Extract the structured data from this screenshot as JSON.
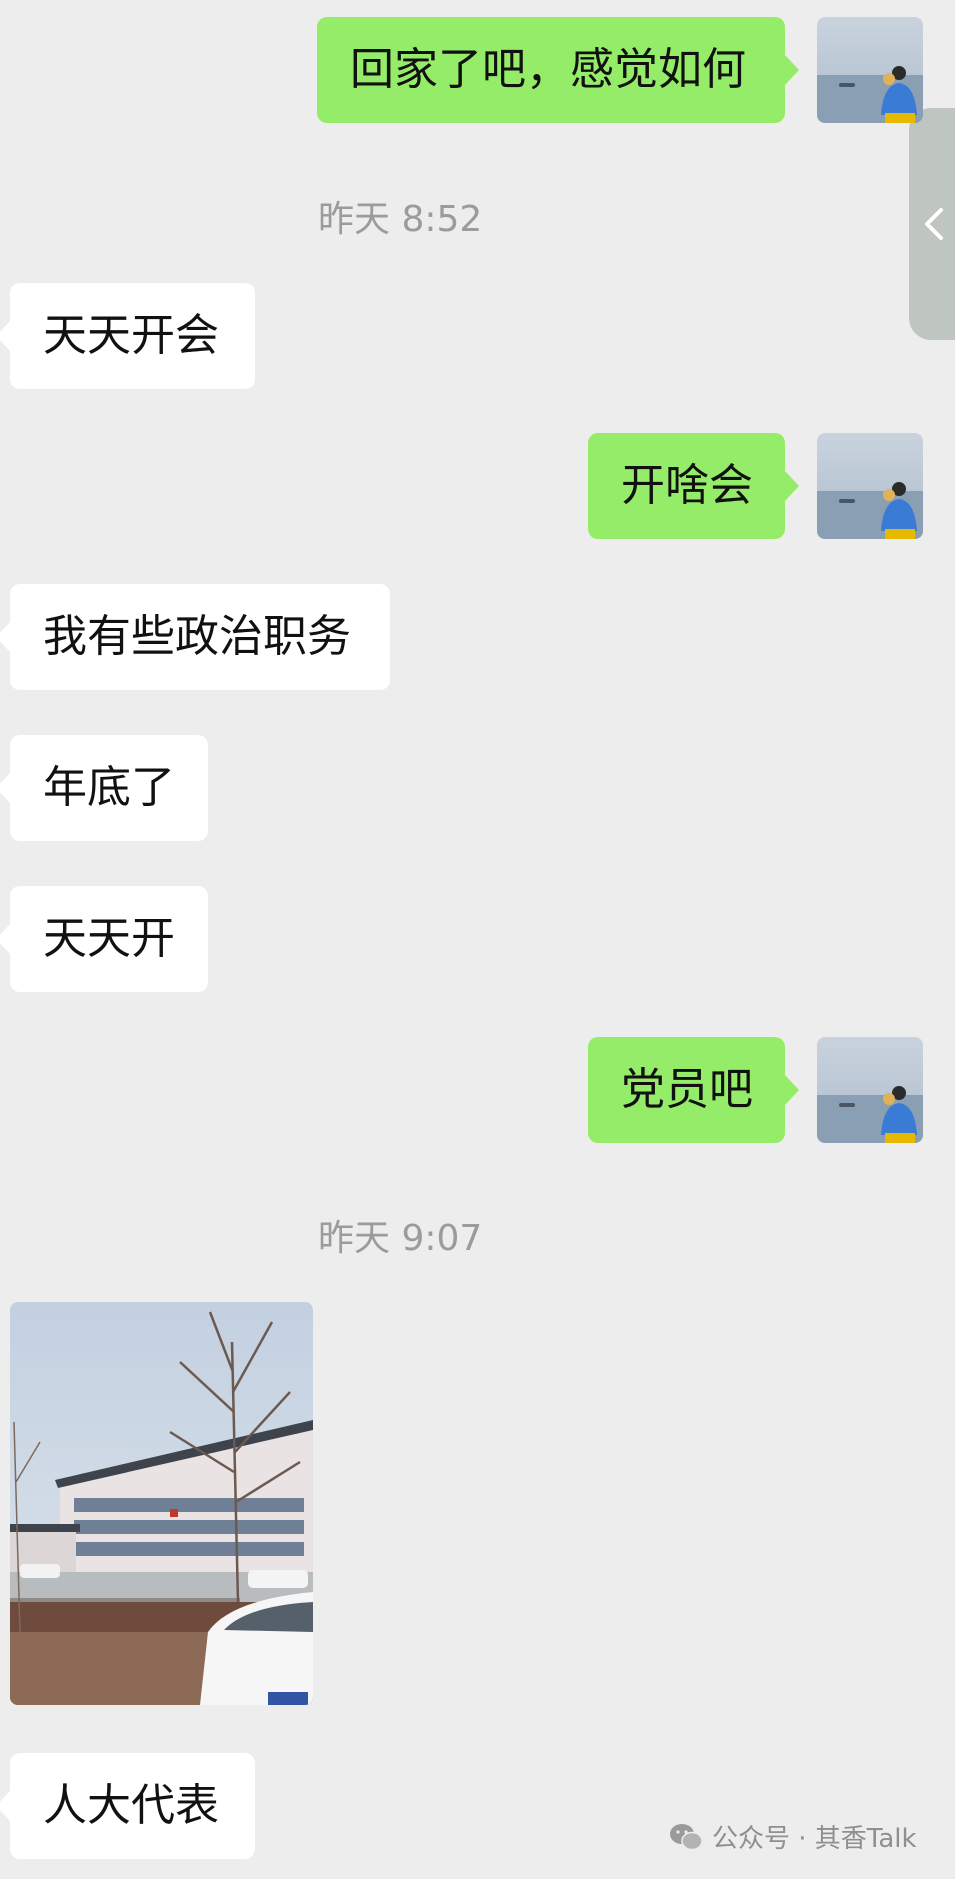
{
  "messages": {
    "m1": "回家了吧，感觉如何",
    "t1": "昨天 8:52",
    "m2": "天天开会",
    "m3": "开啥会",
    "m4": "我有些政治职务",
    "m5": "年底了",
    "m6": "天天开",
    "m7": "党员吧",
    "t2": "昨天 9:07",
    "m8": "人大代表"
  },
  "watermark": {
    "text": "公众号 · 其香Talk"
  },
  "icons": {
    "side_panel": "chevron-left-icon",
    "watermark": "wechat-icon"
  },
  "colors": {
    "background": "#ededed",
    "outgoing_bubble": "#95ec69",
    "incoming_bubble": "#ffffff",
    "timestamp": "#9b9b9b"
  }
}
